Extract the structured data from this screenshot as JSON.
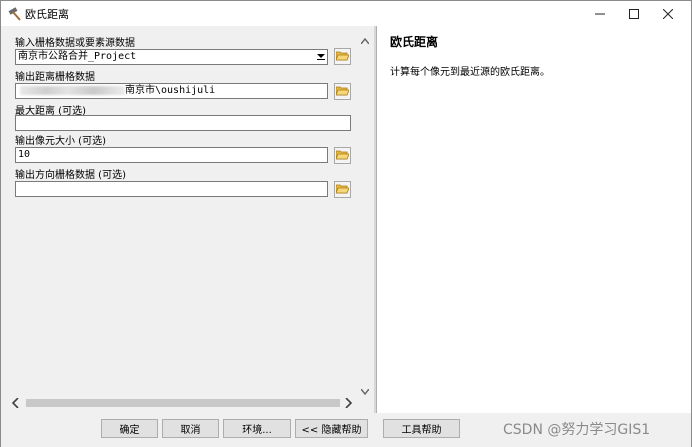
{
  "window": {
    "title": "欧氏距离"
  },
  "form": {
    "input_label": "输入栅格数据或要素源数据",
    "input_value": "南京市公路合并_Project",
    "output_distance_label": "输出距离栅格数据",
    "output_distance_value": "南京市\\oushijuli",
    "max_distance_label": "最大距离 (可选)",
    "max_distance_value": "",
    "cell_size_label": "输出像元大小 (可选)",
    "cell_size_value": "10",
    "direction_label": "输出方向栅格数据 (可选)",
    "direction_value": ""
  },
  "help": {
    "title": "欧氏距离",
    "description": "计算每个像元到最近源的欧氏距离。"
  },
  "buttons": {
    "ok": "确定",
    "cancel": "取消",
    "environments": "环境...",
    "hide_help": "<< 隐藏帮助",
    "tool_help": "工具帮助"
  },
  "watermark": "CSDN @努力学习GIS1",
  "icons": {
    "title": "hammer-icon",
    "browse": "open-folder-icon",
    "dropdown": "dropdown-arrow-icon"
  },
  "colors": {
    "window_bg": "#f0f0f0",
    "pane_bg": "#ffffff",
    "folder": "#e8b840"
  }
}
